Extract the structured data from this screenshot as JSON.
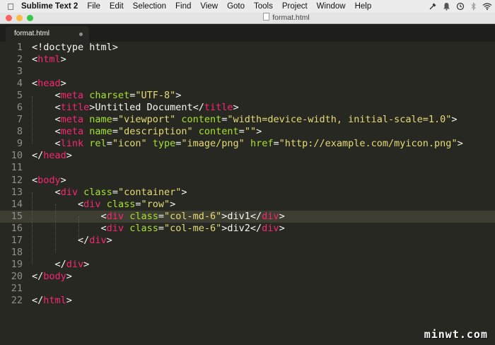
{
  "menubar": {
    "app_name": "Sublime Text 2",
    "items": [
      "File",
      "Edit",
      "Selection",
      "Find",
      "View",
      "Goto",
      "Tools",
      "Project",
      "Window",
      "Help"
    ]
  },
  "window": {
    "title": "format.html",
    "traffic_lights": {
      "close": "#fc605c",
      "minimize": "#fdbc40",
      "zoom": "#34c84a"
    }
  },
  "tab": {
    "label": "format.html"
  },
  "editor": {
    "highlighted_line": 15,
    "theme": {
      "background": "#272822",
      "tag": "#f92672",
      "attribute": "#a6e22e",
      "string": "#e6db74",
      "text": "#f8f8f2",
      "gutter": "#8f908a"
    },
    "lines": [
      {
        "n": "1",
        "tokens": [
          {
            "t": "<!doctype html>",
            "c": "text"
          }
        ]
      },
      {
        "n": "2",
        "tokens": [
          {
            "t": "<",
            "c": "text"
          },
          {
            "t": "html",
            "c": "kw"
          },
          {
            "t": ">",
            "c": "text"
          }
        ]
      },
      {
        "n": "3",
        "tokens": []
      },
      {
        "n": "4",
        "tokens": [
          {
            "t": "<",
            "c": "text"
          },
          {
            "t": "head",
            "c": "kw"
          },
          {
            "t": ">",
            "c": "text"
          }
        ]
      },
      {
        "n": "5",
        "tokens": [
          {
            "t": "    <",
            "c": "text"
          },
          {
            "t": "meta",
            "c": "kw"
          },
          {
            "t": " ",
            "c": "text"
          },
          {
            "t": "charset",
            "c": "at"
          },
          {
            "t": "=",
            "c": "text"
          },
          {
            "t": "\"UTF-8\"",
            "c": "st"
          },
          {
            "t": ">",
            "c": "text"
          }
        ]
      },
      {
        "n": "6",
        "tokens": [
          {
            "t": "    <",
            "c": "text"
          },
          {
            "t": "title",
            "c": "kw"
          },
          {
            "t": ">Untitled Document</",
            "c": "text"
          },
          {
            "t": "title",
            "c": "kw"
          },
          {
            "t": ">",
            "c": "text"
          }
        ]
      },
      {
        "n": "7",
        "tokens": [
          {
            "t": "    <",
            "c": "text"
          },
          {
            "t": "meta",
            "c": "kw"
          },
          {
            "t": " ",
            "c": "text"
          },
          {
            "t": "name",
            "c": "at"
          },
          {
            "t": "=",
            "c": "text"
          },
          {
            "t": "\"viewport\"",
            "c": "st"
          },
          {
            "t": " ",
            "c": "text"
          },
          {
            "t": "content",
            "c": "at"
          },
          {
            "t": "=",
            "c": "text"
          },
          {
            "t": "\"width=device-width, initial-scale=1.0\"",
            "c": "st"
          },
          {
            "t": ">",
            "c": "text"
          }
        ]
      },
      {
        "n": "8",
        "tokens": [
          {
            "t": "    <",
            "c": "text"
          },
          {
            "t": "meta",
            "c": "kw"
          },
          {
            "t": " ",
            "c": "text"
          },
          {
            "t": "name",
            "c": "at"
          },
          {
            "t": "=",
            "c": "text"
          },
          {
            "t": "\"description\"",
            "c": "st"
          },
          {
            "t": " ",
            "c": "text"
          },
          {
            "t": "content",
            "c": "at"
          },
          {
            "t": "=",
            "c": "text"
          },
          {
            "t": "\"\"",
            "c": "st"
          },
          {
            "t": ">",
            "c": "text"
          }
        ]
      },
      {
        "n": "9",
        "tokens": [
          {
            "t": "    <",
            "c": "text"
          },
          {
            "t": "link",
            "c": "kw"
          },
          {
            "t": " ",
            "c": "text"
          },
          {
            "t": "rel",
            "c": "at"
          },
          {
            "t": "=",
            "c": "text"
          },
          {
            "t": "\"icon\"",
            "c": "st"
          },
          {
            "t": " ",
            "c": "text"
          },
          {
            "t": "type",
            "c": "at"
          },
          {
            "t": "=",
            "c": "text"
          },
          {
            "t": "\"image/png\"",
            "c": "st"
          },
          {
            "t": " ",
            "c": "text"
          },
          {
            "t": "href",
            "c": "at"
          },
          {
            "t": "=",
            "c": "text"
          },
          {
            "t": "\"http://example.com/myicon.png\"",
            "c": "st"
          },
          {
            "t": ">",
            "c": "text"
          }
        ]
      },
      {
        "n": "10",
        "tokens": [
          {
            "t": "</",
            "c": "text"
          },
          {
            "t": "head",
            "c": "kw"
          },
          {
            "t": ">",
            "c": "text"
          }
        ]
      },
      {
        "n": "11",
        "tokens": []
      },
      {
        "n": "12",
        "tokens": [
          {
            "t": "<",
            "c": "text"
          },
          {
            "t": "body",
            "c": "kw"
          },
          {
            "t": ">",
            "c": "text"
          }
        ]
      },
      {
        "n": "13",
        "tokens": [
          {
            "t": "    <",
            "c": "text"
          },
          {
            "t": "div",
            "c": "kw"
          },
          {
            "t": " ",
            "c": "text"
          },
          {
            "t": "class",
            "c": "at"
          },
          {
            "t": "=",
            "c": "text"
          },
          {
            "t": "\"container\"",
            "c": "st"
          },
          {
            "t": ">",
            "c": "text"
          }
        ]
      },
      {
        "n": "14",
        "tokens": [
          {
            "t": "        <",
            "c": "text"
          },
          {
            "t": "div",
            "c": "kw"
          },
          {
            "t": " ",
            "c": "text"
          },
          {
            "t": "class",
            "c": "at"
          },
          {
            "t": "=",
            "c": "text"
          },
          {
            "t": "\"row\"",
            "c": "st"
          },
          {
            "t": ">",
            "c": "text"
          }
        ]
      },
      {
        "n": "15",
        "tokens": [
          {
            "t": "            <",
            "c": "text"
          },
          {
            "t": "div",
            "c": "kw"
          },
          {
            "t": " ",
            "c": "text"
          },
          {
            "t": "class",
            "c": "at"
          },
          {
            "t": "=",
            "c": "text"
          },
          {
            "t": "\"col-md-6\"",
            "c": "st"
          },
          {
            "t": ">div1</",
            "c": "text"
          },
          {
            "t": "div",
            "c": "kw"
          },
          {
            "t": ">",
            "c": "text"
          }
        ]
      },
      {
        "n": "16",
        "tokens": [
          {
            "t": "            <",
            "c": "text"
          },
          {
            "t": "div",
            "c": "kw"
          },
          {
            "t": " ",
            "c": "text"
          },
          {
            "t": "class",
            "c": "at"
          },
          {
            "t": "=",
            "c": "text"
          },
          {
            "t": "\"col-me-6\"",
            "c": "st"
          },
          {
            "t": ">div2</",
            "c": "text"
          },
          {
            "t": "div",
            "c": "kw"
          },
          {
            "t": ">",
            "c": "text"
          }
        ]
      },
      {
        "n": "17",
        "tokens": [
          {
            "t": "        </",
            "c": "text"
          },
          {
            "t": "div",
            "c": "kw"
          },
          {
            "t": ">",
            "c": "text"
          }
        ]
      },
      {
        "n": "18",
        "tokens": []
      },
      {
        "n": "19",
        "tokens": [
          {
            "t": "    </",
            "c": "text"
          },
          {
            "t": "div",
            "c": "kw"
          },
          {
            "t": ">",
            "c": "text"
          }
        ]
      },
      {
        "n": "20",
        "tokens": [
          {
            "t": "</",
            "c": "text"
          },
          {
            "t": "body",
            "c": "kw"
          },
          {
            "t": ">",
            "c": "text"
          }
        ]
      },
      {
        "n": "21",
        "tokens": []
      },
      {
        "n": "22",
        "tokens": [
          {
            "t": "</",
            "c": "text"
          },
          {
            "t": "html",
            "c": "kw"
          },
          {
            "t": ">",
            "c": "text"
          }
        ]
      }
    ]
  },
  "watermark": "minwt.com"
}
